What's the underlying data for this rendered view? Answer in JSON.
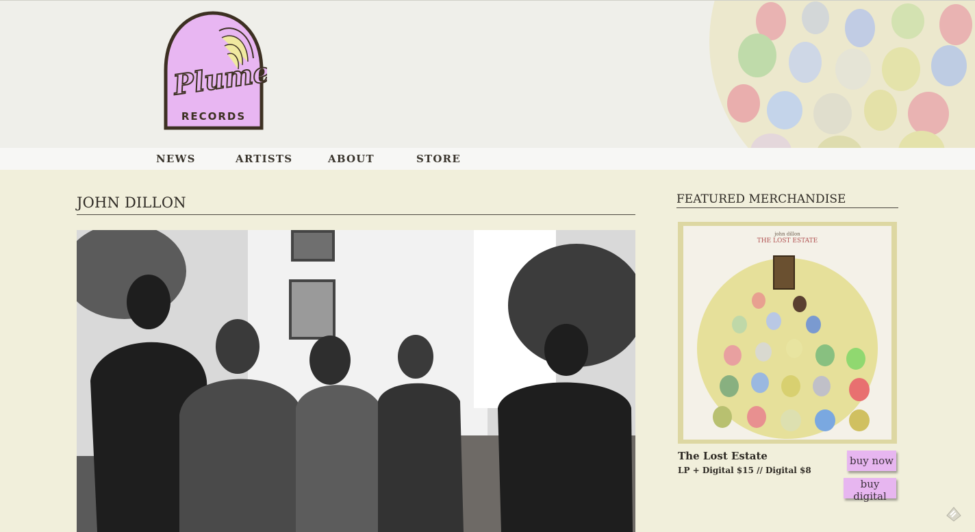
{
  "brand": {
    "logo_text": "Plume",
    "logo_subtext": "RECORDS",
    "logo_color": "#e8b6f2"
  },
  "nav": {
    "items": [
      {
        "label": "NEWS"
      },
      {
        "label": "ARTISTS"
      },
      {
        "label": "ABOUT"
      },
      {
        "label": "STORE"
      }
    ]
  },
  "artist": {
    "name": "JOHN DILLON"
  },
  "sidebar": {
    "heading": "FEATURED MERCHANDISE",
    "product": {
      "cover_artist": "john dillon",
      "cover_title": "THE LOST ESTATE",
      "name": "The Lost Estate",
      "price": "LP + Digital $15 // Digital $8",
      "buy_now_label": "buy now",
      "buy_digital_label": "buy digital"
    }
  },
  "colors": {
    "page_bg": "#f1efdb",
    "header_bg": "#efefea",
    "button_bg": "#e7b6f0"
  }
}
